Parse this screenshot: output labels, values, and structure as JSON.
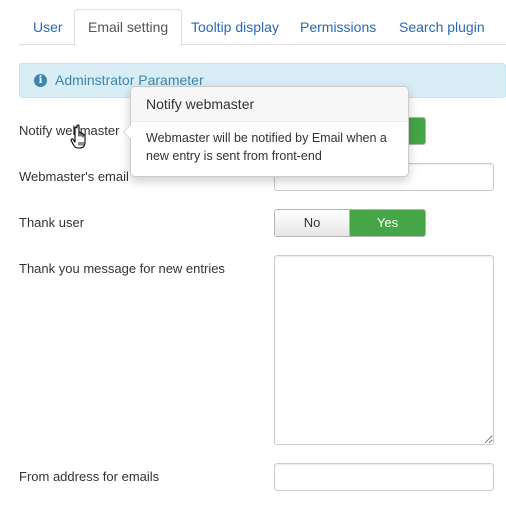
{
  "tabs": [
    {
      "label": "User",
      "active": false
    },
    {
      "label": "Email setting",
      "active": true
    },
    {
      "label": "Tooltip display",
      "active": false
    },
    {
      "label": "Permissions",
      "active": false
    },
    {
      "label": "Search plugin",
      "active": false
    }
  ],
  "alert": {
    "icon": "info-icon",
    "text": "Adminstrator Parameter"
  },
  "fields": {
    "notify_webmaster": {
      "label": "Notify webmaster",
      "selected": "Yes"
    },
    "webmaster_email": {
      "label": "Webmaster's email",
      "value": ""
    },
    "thank_user": {
      "label": "Thank user",
      "no_label": "No",
      "yes_label": "Yes",
      "selected": "Yes"
    },
    "thank_you_message": {
      "label": "Thank you message for new entries",
      "value": ""
    },
    "from_address": {
      "label": "From address for emails",
      "value": ""
    }
  },
  "tooltip": {
    "title": "Notify webmaster",
    "body": "Webmaster will be notified by Email when a new entry is sent from front-end"
  },
  "colors": {
    "tab_link": "#2a69b8",
    "alert_bg": "#d9edf7",
    "alert_text": "#3a87ad",
    "yes_green": "#46a546"
  },
  "cursor": {
    "icon": "hand-pointer-icon"
  }
}
